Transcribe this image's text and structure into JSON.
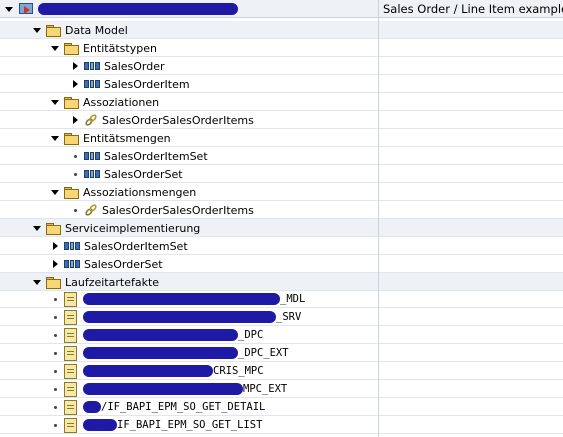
{
  "header": {
    "description": "Sales Order / Line Item example"
  },
  "tree": {
    "data_model": "Data Model",
    "entity_types": "Entitätstypen",
    "entity_types_items": [
      "SalesOrder",
      "SalesOrderItem"
    ],
    "associations": "Assoziationen",
    "associations_items": [
      "SalesOrderSalesOrderItems"
    ],
    "entity_sets": "Entitätsmengen",
    "entity_sets_items": [
      "SalesOrderItemSet",
      "SalesOrderSet"
    ],
    "association_sets": "Assoziationsmengen",
    "association_sets_items": [
      "SalesOrderSalesOrderItems"
    ],
    "service_impl": "Serviceimplementierung",
    "service_impl_items": [
      "SalesOrderItemSet",
      "SalesOrderSet"
    ],
    "runtime_artifacts": "Laufzeitartefakte",
    "runtime_items": [
      "_MDL",
      "_SRV",
      "_DPC",
      "_DPC_EXT",
      "CRIS_MPC",
      "MPC_EXT",
      "/IF_BAPI_EPM_SO_GET_DETAIL",
      "IF_BAPI_EPM_SO_GET_LIST"
    ]
  },
  "colors": {
    "redaction": "#1e1aa6",
    "section_bg": "#eef2f7",
    "grid_line": "#dfe6ee"
  }
}
